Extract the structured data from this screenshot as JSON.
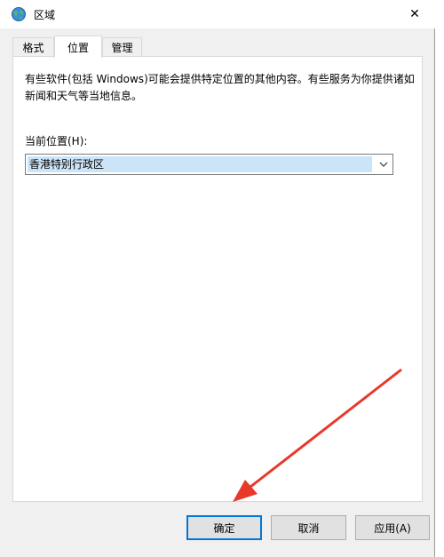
{
  "window": {
    "title": "区域",
    "close_glyph": "✕"
  },
  "tabs": [
    {
      "label": "格式",
      "active": false
    },
    {
      "label": "位置",
      "active": true
    },
    {
      "label": "管理",
      "active": false
    }
  ],
  "location_tab": {
    "description": "有些软件(包括 Windows)可能会提供特定位置的其他内容。有些服务为你提供诸如新闻和天气等当地信息。",
    "current_location_label": "当前位置(H):",
    "current_location_value": "香港特别行政区"
  },
  "buttons": {
    "ok": "确定",
    "cancel": "取消",
    "apply": "应用(A)"
  },
  "colors": {
    "accent": "#0078d7",
    "annotation_arrow": "#e8382a",
    "selection": "#cce4f7"
  },
  "icons": {
    "title": "globe-icon",
    "dropdown": "chevron-down-icon"
  }
}
